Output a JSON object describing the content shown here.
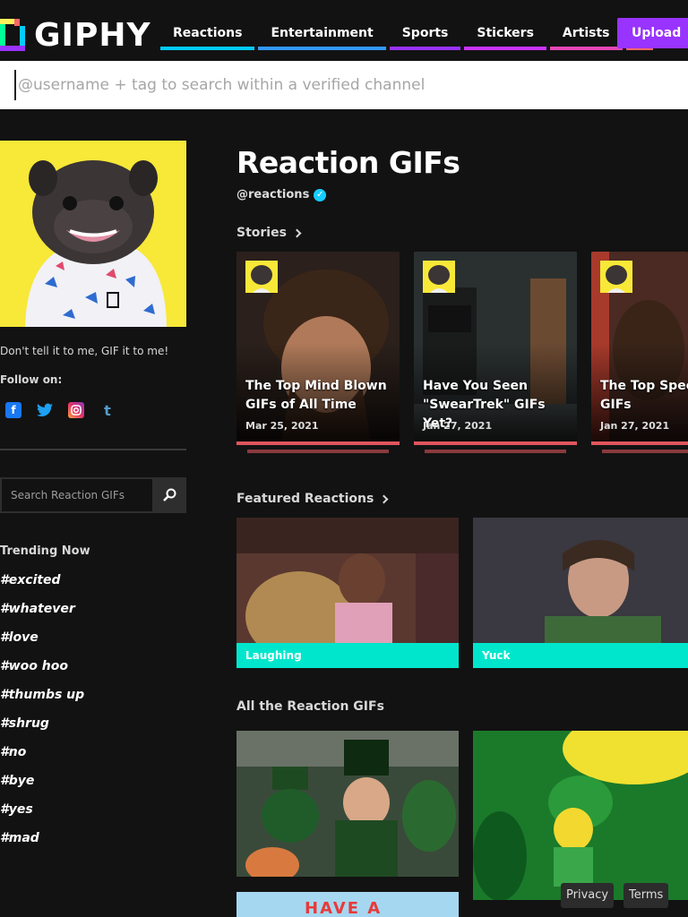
{
  "brand": {
    "name": "GIPHY"
  },
  "nav": {
    "items": [
      {
        "label": "Reactions",
        "color": "#00ccff"
      },
      {
        "label": "Entertainment",
        "color": "#3399ff"
      },
      {
        "label": "Sports",
        "color": "#9933ff"
      },
      {
        "label": "Stickers",
        "color": "#cc33ff"
      },
      {
        "label": "Artists",
        "color": "#e646b6"
      }
    ],
    "more_color": "#ff6666",
    "upload_label": "Upload"
  },
  "search": {
    "placeholder": "@username + tag to search within a verified channel"
  },
  "channel": {
    "title": "Reaction GIFs",
    "handle": "@reactions",
    "tagline": "Don't tell it to me, GIF it to me!",
    "follow_label": "Follow on:",
    "socials": [
      {
        "icon": "facebook-icon",
        "color": "#1877f2"
      },
      {
        "icon": "twitter-icon",
        "color": "#1da1f2"
      },
      {
        "icon": "instagram-icon",
        "color": "#e1306c"
      },
      {
        "icon": "tumblr-icon",
        "color": "#529ecc"
      }
    ],
    "search_placeholder": "Search Reaction GIFs"
  },
  "trending": {
    "heading": "Trending Now",
    "tags": [
      "#excited",
      "#whatever",
      "#love",
      "#woo hoo",
      "#thumbs up",
      "#shrug",
      "#no",
      "#bye",
      "#yes",
      "#mad"
    ]
  },
  "stories": {
    "heading": "Stories",
    "items": [
      {
        "title": "The Top Mind Blown GIFs of All Time",
        "date": "Mar 25, 2021"
      },
      {
        "title": "Have You Seen \"SwearTrek\" GIFs Yet?",
        "date": "Jan 27, 2021"
      },
      {
        "title": "The Top Speechless GIFs",
        "date": "Jan 27, 2021"
      }
    ]
  },
  "featured": {
    "heading": "Featured Reactions",
    "items": [
      {
        "label": "Laughing"
      },
      {
        "label": "Yuck"
      }
    ]
  },
  "all": {
    "heading": "All the Reaction GIFs",
    "partial_text": "HAVE A"
  },
  "footer": {
    "privacy": "Privacy",
    "terms": "Terms"
  }
}
